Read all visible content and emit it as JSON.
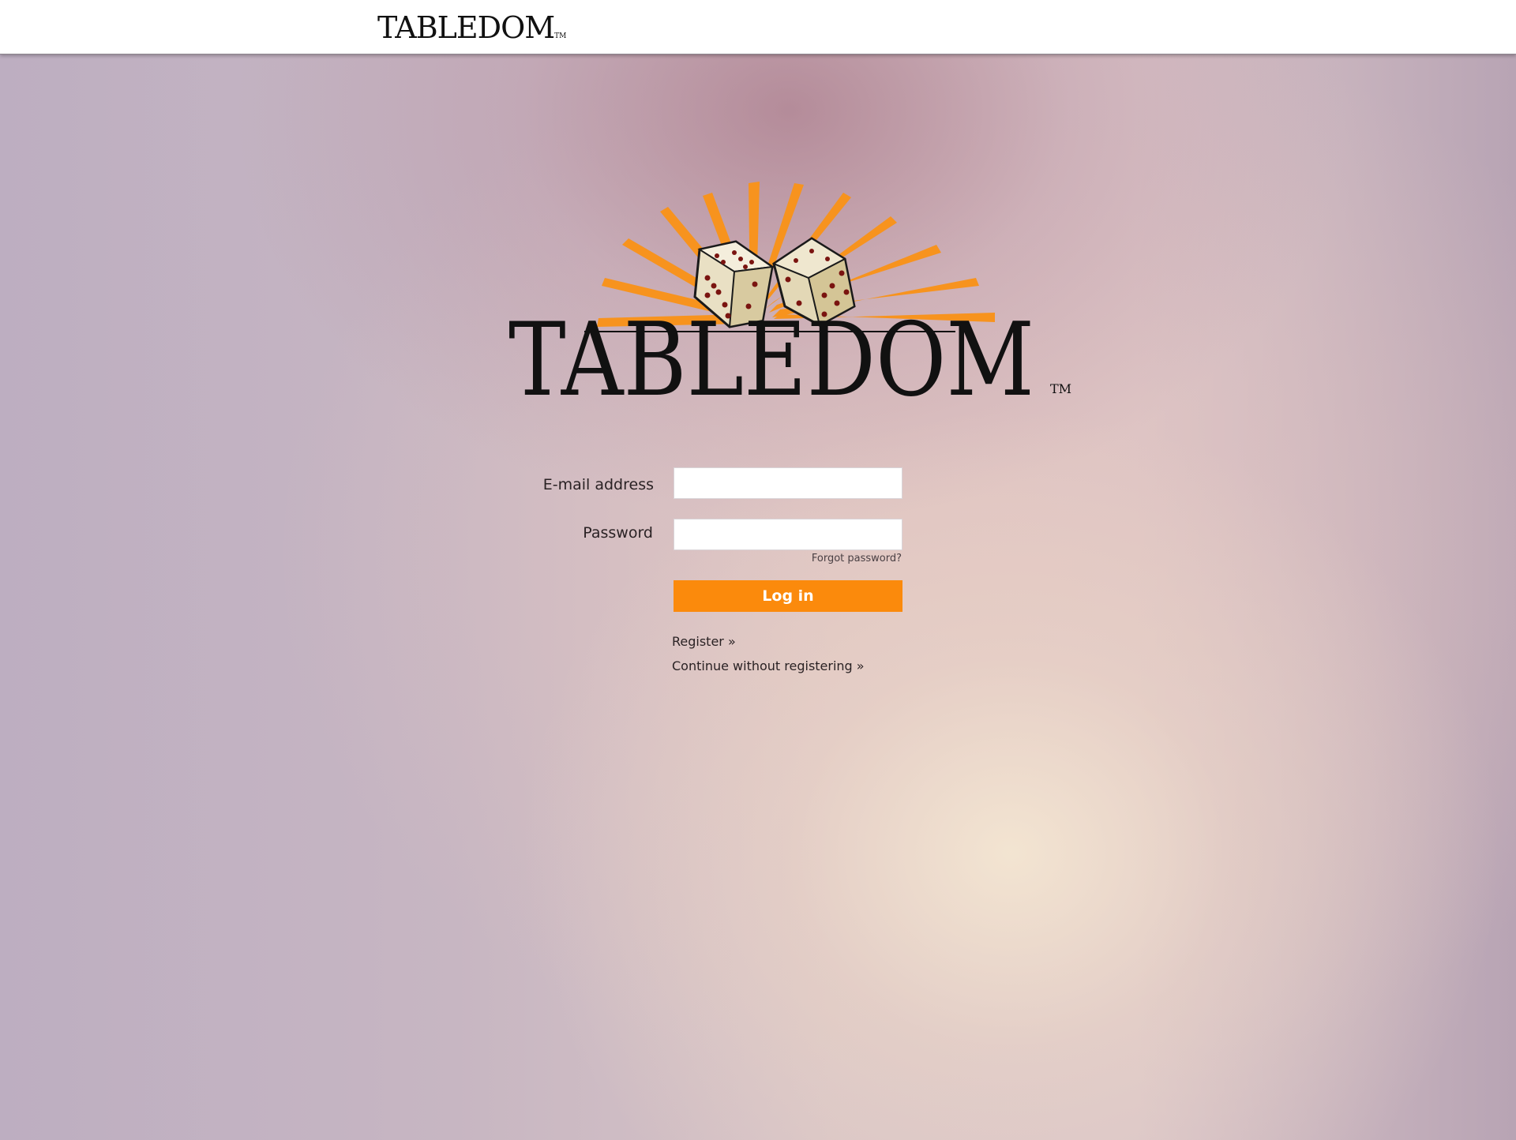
{
  "header": {
    "logo_text": "TABLEDOM",
    "logo_tm": "TM"
  },
  "logo": {
    "text": "TABLEDOM",
    "tm": "TM",
    "icon": "dice-sunburst-logo",
    "colors": {
      "rays": "#f7931e",
      "dice": "#e9e0c4",
      "pips": "#7a1410",
      "text": "#111111"
    }
  },
  "form": {
    "email_label": "E-mail address",
    "email_value": "",
    "password_label": "Password",
    "password_value": "",
    "forgot_link": "Forgot password?",
    "login_button": "Log in",
    "login_color": "#fb8a0c",
    "register_link": "Register »",
    "guest_link": "Continue without registering »"
  }
}
